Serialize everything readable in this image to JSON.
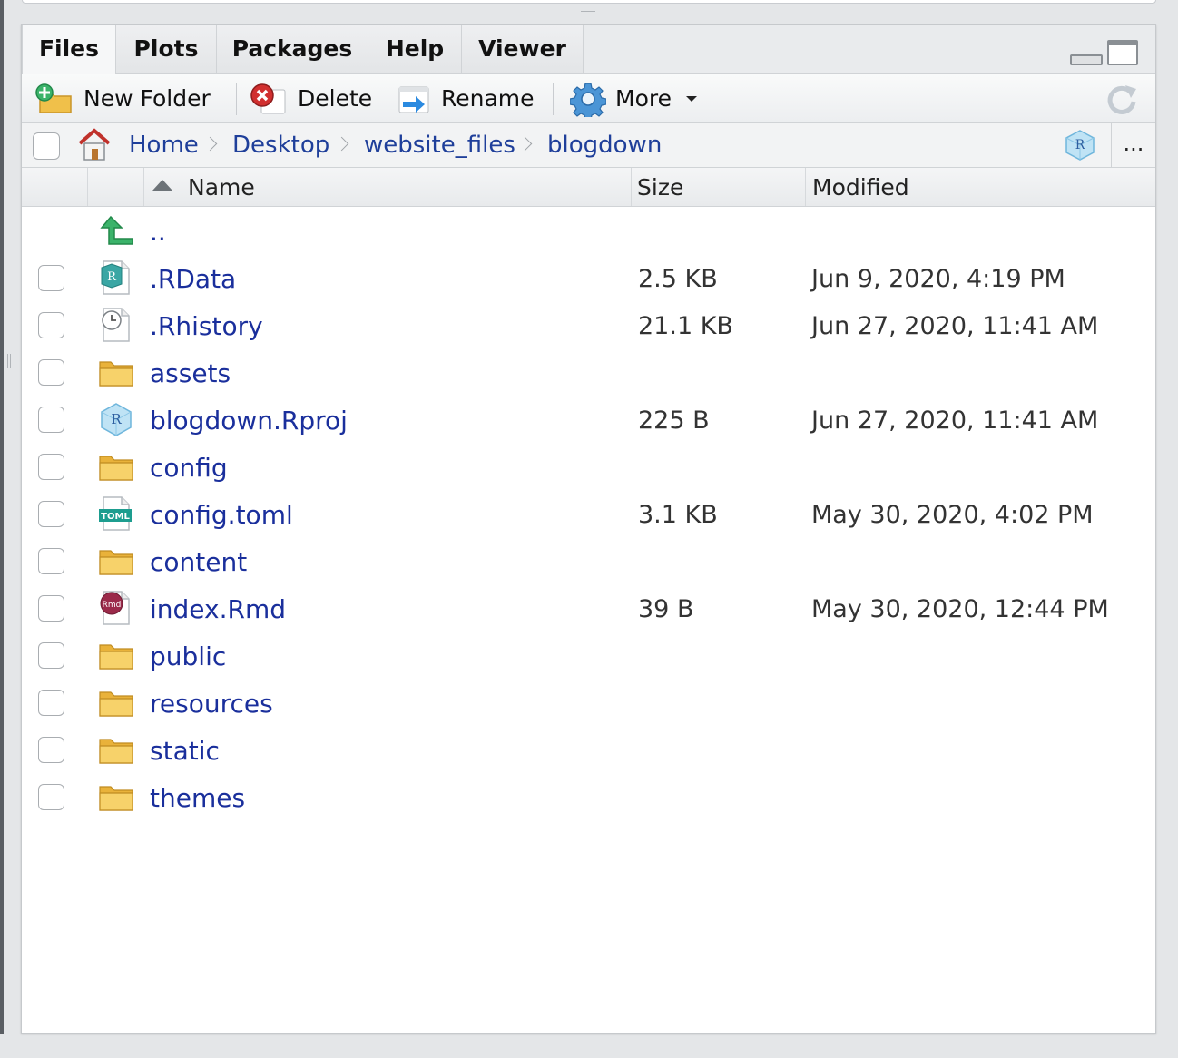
{
  "tabs": [
    {
      "label": "Files",
      "active": true
    },
    {
      "label": "Plots"
    },
    {
      "label": "Packages"
    },
    {
      "label": "Help"
    },
    {
      "label": "Viewer"
    }
  ],
  "toolbar": {
    "new_folder": "New Folder",
    "delete": "Delete",
    "rename": "Rename",
    "more": "More"
  },
  "breadcrumb": {
    "items": [
      "Home",
      "Desktop",
      "website_files",
      "blogdown"
    ],
    "more": "..."
  },
  "columns": {
    "name": "Name",
    "size": "Size",
    "modified": "Modified"
  },
  "files": [
    {
      "name": "..",
      "size": "",
      "modified": "",
      "icon": "parent-dir-icon"
    },
    {
      "name": ".RData",
      "size": "2.5 KB",
      "modified": "Jun 9, 2020, 4:19 PM",
      "icon": "rdata-file-icon"
    },
    {
      "name": ".Rhistory",
      "size": "21.1 KB",
      "modified": "Jun 27, 2020, 11:41 AM",
      "icon": "history-file-icon"
    },
    {
      "name": "assets",
      "size": "",
      "modified": "",
      "icon": "folder-icon"
    },
    {
      "name": "blogdown.Rproj",
      "size": "225 B",
      "modified": "Jun 27, 2020, 11:41 AM",
      "icon": "rproj-file-icon"
    },
    {
      "name": "config",
      "size": "",
      "modified": "",
      "icon": "folder-icon"
    },
    {
      "name": "config.toml",
      "size": "3.1 KB",
      "modified": "May 30, 2020, 4:02 PM",
      "icon": "toml-file-icon"
    },
    {
      "name": "content",
      "size": "",
      "modified": "",
      "icon": "folder-icon"
    },
    {
      "name": "index.Rmd",
      "size": "39 B",
      "modified": "May 30, 2020, 12:44 PM",
      "icon": "rmd-file-icon"
    },
    {
      "name": "public",
      "size": "",
      "modified": "",
      "icon": "folder-icon"
    },
    {
      "name": "resources",
      "size": "",
      "modified": "",
      "icon": "folder-icon"
    },
    {
      "name": "static",
      "size": "",
      "modified": "",
      "icon": "folder-icon"
    },
    {
      "name": "themes",
      "size": "",
      "modified": "",
      "icon": "folder-icon"
    }
  ],
  "icon_labels": {
    "rdata": "R",
    "rproj": "R",
    "toml": "TOML",
    "rmd": "Rmd"
  },
  "colors": {
    "link": "#1a2f9c",
    "breadcrumb_link": "#1f3f9a",
    "folder": "#f3c34c"
  }
}
